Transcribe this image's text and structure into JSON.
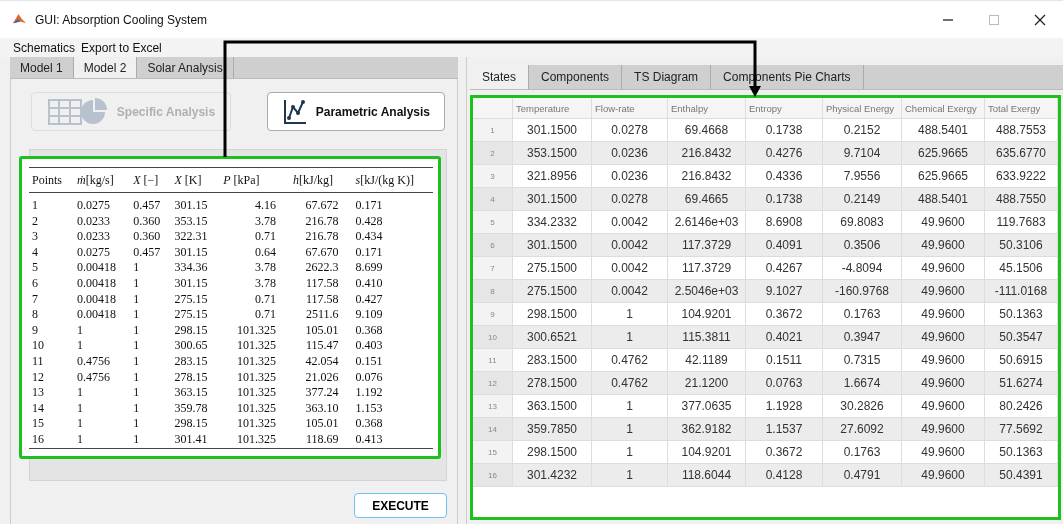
{
  "window": {
    "title": "GUI: Absorption Cooling System"
  },
  "menu": [
    "Schematics",
    "Export to Excel"
  ],
  "left_panel": {
    "tabs": [
      {
        "label": "Model 1",
        "selected": false
      },
      {
        "label": "Model 2",
        "selected": true
      },
      {
        "label": "Solar Analysis",
        "selected": false
      }
    ],
    "buttons": [
      {
        "label": "Specific Analysis",
        "kind": "table-pie",
        "disabled": true
      },
      {
        "label": "Parametric Analysis",
        "kind": "line-plot",
        "disabled": false
      }
    ],
    "table": {
      "columns": [
        "Points",
        "*ṁ*[kg/s]",
        "*X* [−]",
        "*X* [K]",
        "*P* [kPa]",
        "*h*[kJ/kg]",
        "*s*[kJ/(kg K)]"
      ],
      "rows": [
        [
          "1",
          "0.0275",
          "0.457",
          "301.15",
          "4.16",
          "67.672",
          "0.171"
        ],
        [
          "2",
          "0.0233",
          "0.360",
          "353.15",
          "3.78",
          "216.78",
          "0.428"
        ],
        [
          "3",
          "0.0233",
          "0.360",
          "322.31",
          "0.71",
          "216.78",
          "0.434"
        ],
        [
          "4",
          "0.0275",
          "0.457",
          "301.15",
          "0.64",
          "67.670",
          "0.171"
        ],
        [
          "5",
          "0.00418",
          "1",
          "334.36",
          "3.78",
          "2622.3",
          "8.699"
        ],
        [
          "6",
          "0.00418",
          "1",
          "301.15",
          "3.78",
          "117.58",
          "0.410"
        ],
        [
          "7",
          "0.00418",
          "1",
          "275.15",
          "0.71",
          "117.58",
          "0.427"
        ],
        [
          "8",
          "0.00418",
          "1",
          "275.15",
          "0.71",
          "2511.6",
          "9.109"
        ],
        [
          "9",
          "1",
          "1",
          "298.15",
          "101.325",
          "105.01",
          "0.368"
        ],
        [
          "10",
          "1",
          "1",
          "300.65",
          "101.325",
          "115.47",
          "0.403"
        ],
        [
          "11",
          "0.4756",
          "1",
          "283.15",
          "101.325",
          "42.054",
          "0.151"
        ],
        [
          "12",
          "0.4756",
          "1",
          "278.15",
          "101.325",
          "21.026",
          "0.076"
        ],
        [
          "13",
          "1",
          "1",
          "363.15",
          "101.325",
          "377.24",
          "1.192"
        ],
        [
          "14",
          "1",
          "1",
          "359.78",
          "101.325",
          "363.10",
          "1.153"
        ],
        [
          "15",
          "1",
          "1",
          "298.15",
          "101.325",
          "105.01",
          "0.368"
        ],
        [
          "16",
          "1",
          "1",
          "301.41",
          "101.325",
          "118.69",
          "0.413"
        ]
      ]
    },
    "execute_button": "EXECUTE"
  },
  "right_panel": {
    "tabs": [
      {
        "label": "States",
        "selected": true
      },
      {
        "label": "Components",
        "selected": false
      },
      {
        "label": "TS Diagram",
        "selected": false
      },
      {
        "label": "Components Pie Charts",
        "selected": false
      }
    ],
    "table": {
      "columns": [
        "Temperature",
        "Flow-rate",
        "Enthalpy",
        "Entropy",
        "Physical Energy",
        "Chemical Exergy",
        "Total Exergy"
      ],
      "rows": [
        {
          "header": "1",
          "cells": [
            "301.1500",
            "0.0278",
            "69.4668",
            "0.1738",
            "0.2152",
            "488.5401",
            "488.7553"
          ]
        },
        {
          "header": "2",
          "cells": [
            "353.1500",
            "0.0236",
            "216.8432",
            "0.4276",
            "9.7104",
            "625.9665",
            "635.6770"
          ]
        },
        {
          "header": "3",
          "cells": [
            "321.8956",
            "0.0236",
            "216.8432",
            "0.4336",
            "7.9556",
            "625.9665",
            "633.9222"
          ]
        },
        {
          "header": "4",
          "cells": [
            "301.1500",
            "0.0278",
            "69.4665",
            "0.1738",
            "0.2149",
            "488.5401",
            "488.7550"
          ]
        },
        {
          "header": "5",
          "cells": [
            "334.2332",
            "0.0042",
            "2.6146e+03",
            "8.6908",
            "69.8083",
            "49.9600",
            "119.7683"
          ]
        },
        {
          "header": "6",
          "cells": [
            "301.1500",
            "0.0042",
            "117.3729",
            "0.4091",
            "0.3506",
            "49.9600",
            "50.3106"
          ]
        },
        {
          "header": "7",
          "cells": [
            "275.1500",
            "0.0042",
            "117.3729",
            "0.4267",
            "-4.8094",
            "49.9600",
            "45.1506"
          ]
        },
        {
          "header": "8",
          "cells": [
            "275.1500",
            "0.0042",
            "2.5046e+03",
            "9.1027",
            "-160.9768",
            "49.9600",
            "-111.0168"
          ]
        },
        {
          "header": "9",
          "cells": [
            "298.1500",
            "1",
            "104.9201",
            "0.3672",
            "0.1763",
            "49.9600",
            "50.1363"
          ]
        },
        {
          "header": "10",
          "cells": [
            "300.6521",
            "1",
            "115.3811",
            "0.4021",
            "0.3947",
            "49.9600",
            "50.3547"
          ]
        },
        {
          "header": "11",
          "cells": [
            "283.1500",
            "0.4762",
            "42.1189",
            "0.1511",
            "0.7315",
            "49.9600",
            "50.6915"
          ]
        },
        {
          "header": "12",
          "cells": [
            "278.1500",
            "0.4762",
            "21.1200",
            "0.0763",
            "1.6674",
            "49.9600",
            "51.6274"
          ]
        },
        {
          "header": "13",
          "cells": [
            "363.1500",
            "1",
            "377.0635",
            "1.1928",
            "30.2826",
            "49.9600",
            "80.2426"
          ]
        },
        {
          "header": "14",
          "cells": [
            "359.7850",
            "1",
            "362.9182",
            "1.1537",
            "27.6092",
            "49.9600",
            "77.5692"
          ]
        },
        {
          "header": "15",
          "cells": [
            "298.1500",
            "1",
            "104.9201",
            "0.3672",
            "0.1763",
            "49.9600",
            "50.1363"
          ]
        },
        {
          "header": "16",
          "cells": [
            "301.4232",
            "1",
            "118.6044",
            "0.4128",
            "0.4791",
            "49.9600",
            "50.4391"
          ]
        }
      ]
    }
  }
}
